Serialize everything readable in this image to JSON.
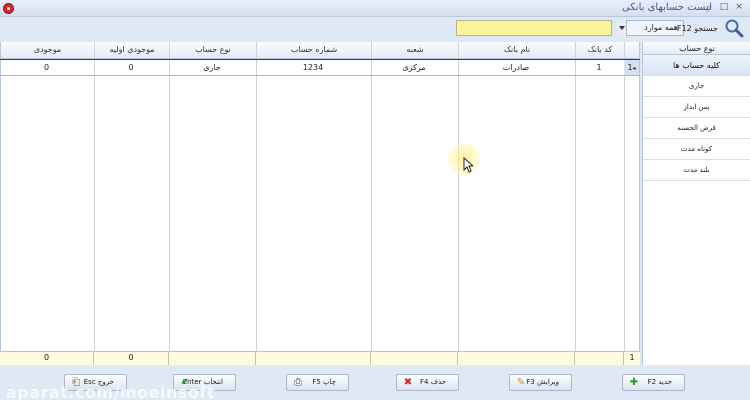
{
  "window": {
    "title": "لیست حسابهای بانکی",
    "controls": [
      "–",
      "□",
      "×"
    ]
  },
  "search": {
    "label": "جستجو F12",
    "scope": "همه موارد",
    "value": ""
  },
  "grid": {
    "columns": [
      "کد بانک",
      "نام بانک",
      "شعبه",
      "شماره حساب",
      "نوع حساب",
      "موجودی اولیه",
      "موجودی"
    ],
    "rows": [
      {
        "indicator": "1",
        "bank_code": "1",
        "bank_name": "صادرات",
        "branch": "مرکزی",
        "account_number": "1234",
        "account_type": "جاری",
        "initial_balance": "0",
        "balance": "0"
      }
    ],
    "footer": {
      "count": "1",
      "initial_balance_total": "0",
      "balance_total": "0"
    }
  },
  "sidebar": {
    "header": "نوع حساب",
    "items": [
      "کلیه حساب ها",
      "جاری",
      "پس انداز",
      "قرض الحسنه",
      "کوتاه مدت",
      "بلند مدت"
    ]
  },
  "buttons": {
    "new": "جدید F2",
    "edit": "ویرایش F3",
    "delete": "حذف F4",
    "print": "چاپ F5",
    "select": "انتخاب Enter",
    "exit": "خروج Esc"
  },
  "watermark": "aparat.com/moeinsoft"
}
